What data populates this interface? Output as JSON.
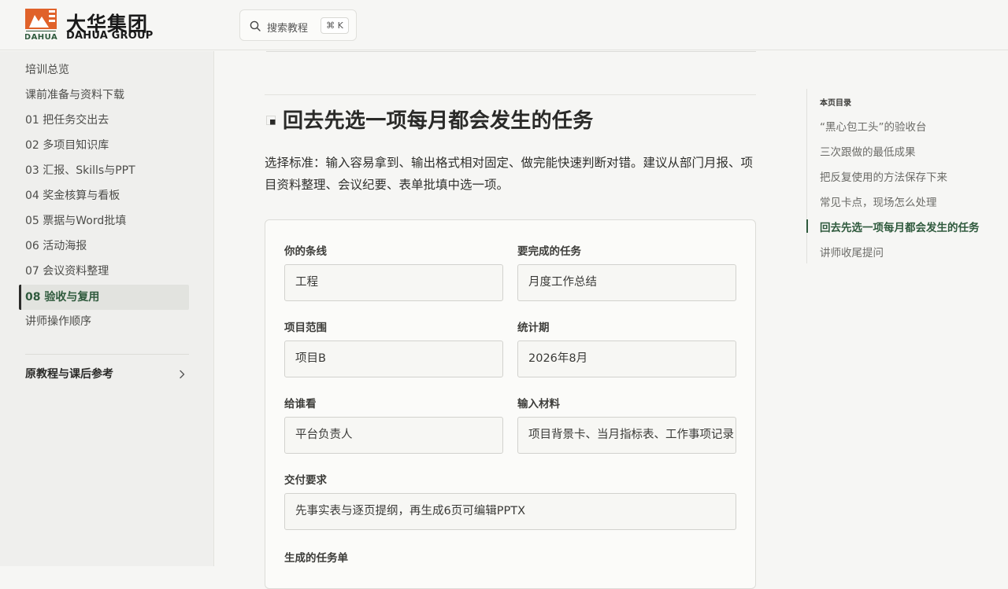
{
  "brand": {
    "name_cn": "大华集团",
    "name_en": "DAHUA GROUP",
    "logo_text": "DAHUA",
    "accent": "#e0622a"
  },
  "search": {
    "placeholder": "搜索教程",
    "shortcut": "⌘ K"
  },
  "sidebar": {
    "items": [
      {
        "label": "培训总览"
      },
      {
        "label": "课前准备与资料下载"
      },
      {
        "label": "01 把任务交出去"
      },
      {
        "label": "02 多项目知识库"
      },
      {
        "label": "03 汇报、Skills与PPT"
      },
      {
        "label": "04 奖金核算与看板"
      },
      {
        "label": "05 票据与Word批填"
      },
      {
        "label": "06 活动海报"
      },
      {
        "label": "07 会议资料整理"
      },
      {
        "label": "08 验收与复用",
        "active": true
      },
      {
        "label": "讲师操作顺序"
      }
    ],
    "group": {
      "label": "原教程与课后参考",
      "icon": "chevron-right-icon"
    }
  },
  "main": {
    "heading": "回去先选一项每月都会发生的任务",
    "paragraph": "选择标准：输入容易拿到、输出格式相对固定、做完能快速判断对错。建议从部门月报、项目资料整理、会议纪要、表单批填中选一项。",
    "form": {
      "line": {
        "label": "你的条线",
        "value": "工程"
      },
      "task": {
        "label": "要完成的任务",
        "value": "月度工作总结"
      },
      "scope": {
        "label": "项目范围",
        "value": "项目B"
      },
      "period": {
        "label": "统计期",
        "value": "2026年8月"
      },
      "audience": {
        "label": "给谁看",
        "value": "平台负责人"
      },
      "inputs": {
        "label": "输入材料",
        "value": "项目背景卡、当月指标表、工作事项记录"
      },
      "requirement": {
        "label": "交付要求",
        "value": "先事实表与逐页提纲，再生成6页可编辑PPTX"
      },
      "output_label": "生成的任务单"
    }
  },
  "toc": {
    "title": "本页目录",
    "items": [
      {
        "label": "“黑心包工头”的验收台"
      },
      {
        "label": "三次跟做的最低成果"
      },
      {
        "label": "把反复使用的方法保存下来"
      },
      {
        "label": "常见卡点，现场怎么处理"
      },
      {
        "label": "回去先选一项每月都会发生的任务",
        "active": true
      },
      {
        "label": "讲师收尾提问"
      }
    ]
  }
}
